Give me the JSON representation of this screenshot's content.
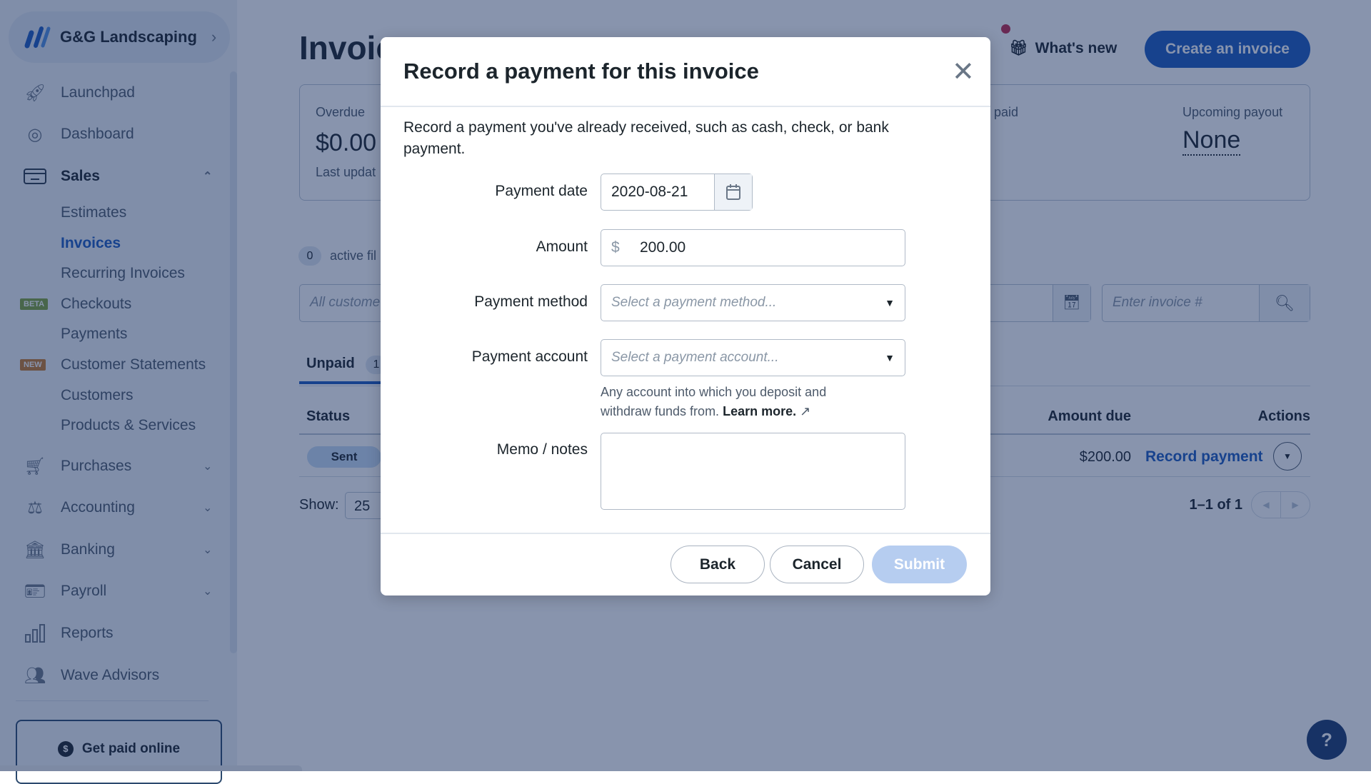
{
  "sidebar": {
    "org_name": "G&G Landscaping",
    "items": [
      {
        "label": "Launchpad",
        "icon": "rocket-icon"
      },
      {
        "label": "Dashboard",
        "icon": "dashboard-icon"
      },
      {
        "label": "Sales",
        "icon": "credit-card-icon"
      },
      {
        "label": "Estimates"
      },
      {
        "label": "Invoices"
      },
      {
        "label": "Recurring Invoices"
      },
      {
        "label": "Checkouts",
        "badge": "BETA"
      },
      {
        "label": "Payments"
      },
      {
        "label": "Customer Statements",
        "badge": "NEW"
      },
      {
        "label": "Customers"
      },
      {
        "label": "Products & Services"
      },
      {
        "label": "Purchases",
        "icon": "cart-icon"
      },
      {
        "label": "Accounting",
        "icon": "scale-icon"
      },
      {
        "label": "Banking",
        "icon": "bank-icon"
      },
      {
        "label": "Payroll",
        "icon": "id-card-icon"
      },
      {
        "label": "Reports",
        "icon": "bar-chart-icon"
      },
      {
        "label": "Wave Advisors",
        "icon": "people-icon"
      }
    ],
    "get_paid": "Get paid online",
    "colors": {
      "active": "#1c5bbf",
      "beta": "#7fa33a",
      "new": "#c77a2c"
    }
  },
  "main": {
    "title": "Invoic",
    "whats_new": "What's new",
    "create": "Create an invoice",
    "summary": {
      "overdue_label": "Overdue",
      "overdue_value": "$0.00",
      "last_updated": "Last updat",
      "paid_label": "t paid",
      "payout_label": "Upcoming payout",
      "payout_value": "None"
    },
    "filters": {
      "count": "0",
      "label": "active fil",
      "customer_placeholder": "All custome",
      "invoice_placeholder": "Enter invoice #"
    },
    "tabs": {
      "unpaid": "Unpaid",
      "unpaid_count": "1"
    },
    "table": {
      "status": "Status",
      "amount_due": "Amount due",
      "actions": "Actions",
      "row": {
        "status": "Sent",
        "amount": "$200.00",
        "action": "Record payment"
      }
    },
    "show_label": "Show:",
    "show_value": "25",
    "pagination": "1–1 of 1"
  },
  "modal": {
    "title": "Record a payment for this invoice",
    "description": "Record a payment you've already received, such as cash, check, or bank payment.",
    "date_label": "Payment date",
    "date_value": "2020-08-21",
    "amount_label": "Amount",
    "currency": "$",
    "amount_value": "200.00",
    "method_label": "Payment method",
    "method_placeholder": "Select a payment method...",
    "account_label": "Payment account",
    "account_placeholder": "Select a payment account...",
    "help_text": "Any account into which you deposit and withdraw funds from.",
    "learn_more": "Learn more.",
    "memo_label": "Memo / notes",
    "back": "Back",
    "cancel": "Cancel",
    "submit": "Submit",
    "colors": {
      "submit_disabled": "#b6cdf0"
    }
  }
}
